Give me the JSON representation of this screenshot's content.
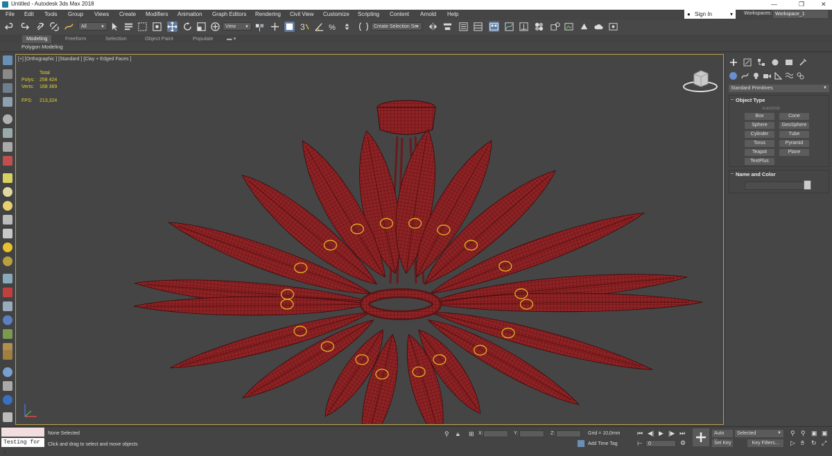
{
  "window": {
    "title": "Untitled - Autodesk 3ds Max 2018",
    "minimize": "—",
    "maximize": "❐",
    "close": "✕"
  },
  "menubar": {
    "items": [
      "File",
      "Edit",
      "Tools",
      "Group",
      "Views",
      "Create",
      "Modifiers",
      "Animation",
      "Graph Editors",
      "Rendering",
      "Civil View",
      "Customize",
      "Scripting",
      "Content",
      "Arnold",
      "Help"
    ],
    "sign_in": "Sign In",
    "workspaces_label": "Workspaces:",
    "workspace_value": "Workspace_1"
  },
  "toolbar": {
    "selection_filter": "All",
    "ref_coord": "View",
    "named_selection": "Create Selection Se"
  },
  "ribbon": {
    "tabs": [
      "Modeling",
      "Freeform",
      "Selection",
      "Object Paint",
      "Populate"
    ],
    "active_tab": "Modeling",
    "sub_label": "Polygon Modeling"
  },
  "viewport": {
    "label": "[+] [Orthographic ] [Standard ] [Clay + Edged Faces ]",
    "stats": {
      "total_label": "Total",
      "polys_label": "Polys:",
      "polys_value": "258 424",
      "verts_label": "Verts:",
      "verts_value": "168 369",
      "fps_label": "FPS:",
      "fps_value": "213,324"
    },
    "model_color": "#8a1c1e",
    "highlight_color": "#e6b422"
  },
  "command_panel": {
    "category": "Standard Primitives",
    "object_type_title": "Object Type",
    "autogrid": "AutoGrid",
    "buttons": [
      "Box",
      "Cone",
      "Sphere",
      "GeoSphere",
      "Cylinder",
      "Tube",
      "Torus",
      "Pyramid",
      "Teapot",
      "Plane",
      "TextPlus"
    ],
    "name_color_title": "Name and Color"
  },
  "status": {
    "maxscript_text": "Testing for ;",
    "selection": "None Selected",
    "prompt": "Click and drag to select and move objects",
    "x_label": "X:",
    "y_label": "Y:",
    "z_label": "Z:",
    "grid": "Grid = 10,0mm",
    "add_time_tag": "Add Time Tag",
    "frame": "0",
    "auto_key": "Auto Key",
    "set_key": "Set Key",
    "selected": "Selected",
    "key_filters": "Key Filters..."
  }
}
